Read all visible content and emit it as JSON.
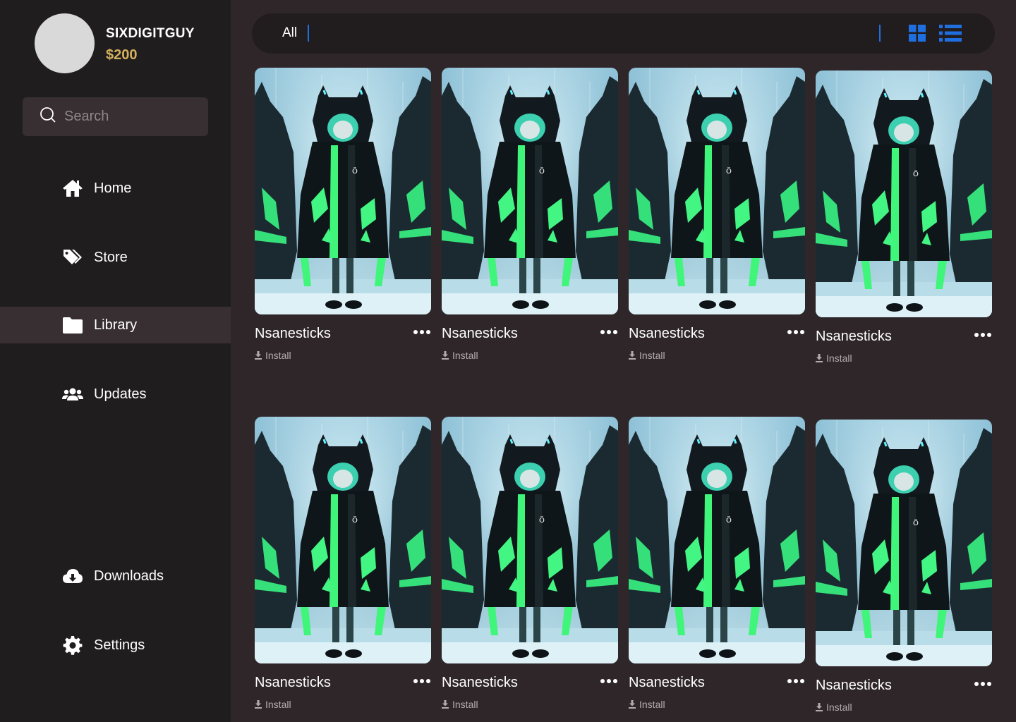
{
  "profile": {
    "username": "SIXDIGITGUY",
    "balance": "$200"
  },
  "search": {
    "placeholder": "Search",
    "value": ""
  },
  "nav": [
    {
      "label": "Home",
      "icon": "home-icon"
    },
    {
      "label": "Store",
      "icon": "tag-icon"
    },
    {
      "label": "Library",
      "icon": "folder-icon",
      "active": true
    },
    {
      "label": "Updates",
      "icon": "users-icon"
    },
    {
      "label": "Downloads",
      "icon": "cloud-download-icon"
    },
    {
      "label": "Settings",
      "icon": "gear-icon"
    }
  ],
  "filter": {
    "label": "All"
  },
  "colors": {
    "accent": "#1f6fe0",
    "balance": "#d4b15f",
    "sidebar": "#201d1e",
    "background": "#2f2629"
  },
  "library": {
    "items": [
      {
        "title": "Nsanesticks",
        "action": "Install"
      },
      {
        "title": "Nsanesticks",
        "action": "Install"
      },
      {
        "title": "Nsanesticks",
        "action": "Install"
      },
      {
        "title": "Nsanesticks",
        "action": "Install"
      },
      {
        "title": "Nsanesticks",
        "action": "Install"
      },
      {
        "title": "Nsanesticks",
        "action": "Install"
      },
      {
        "title": "Nsanesticks",
        "action": "Install"
      },
      {
        "title": "Nsanesticks",
        "action": "Install"
      }
    ]
  }
}
